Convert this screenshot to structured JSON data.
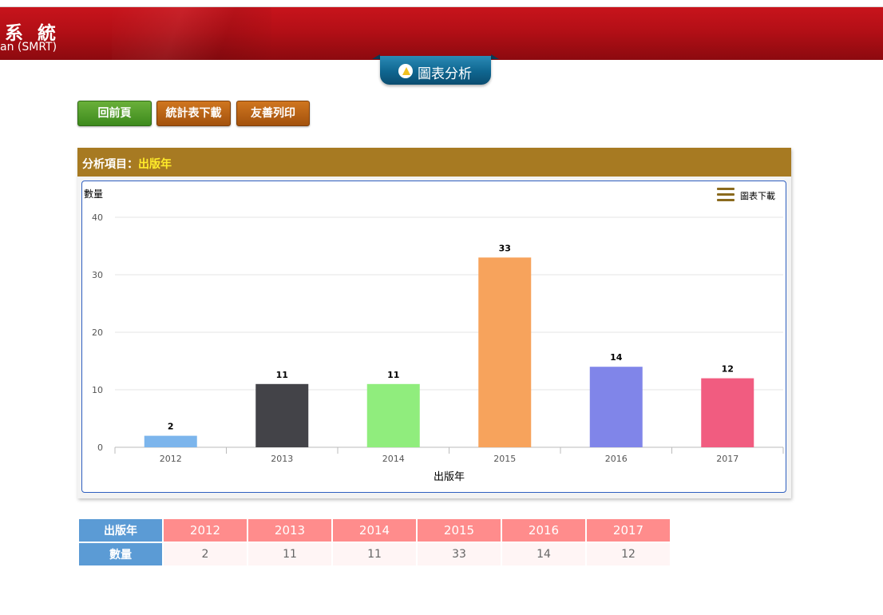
{
  "header": {
    "system_title": "系 統",
    "system_subtitle": "an (SMRT)"
  },
  "section_ribbon": {
    "label": "圖表分析",
    "icon": "chart-logo-icon"
  },
  "toolbar": {
    "back_label": "回前頁",
    "download_label": "統計表下載",
    "print_label": "友善列印"
  },
  "panel": {
    "item_key": "分析項目：",
    "item_value": "出版年"
  },
  "chart_menu": {
    "label": "圖表下載",
    "icon": "hamburger-menu-icon"
  },
  "chart_data": {
    "type": "bar",
    "title": "",
    "xlabel": "出版年",
    "ylabel": "數量",
    "categories": [
      "2012",
      "2013",
      "2014",
      "2015",
      "2016",
      "2017"
    ],
    "values": [
      2,
      11,
      11,
      33,
      14,
      12
    ],
    "colors": [
      "#7cb5ec",
      "#434348",
      "#90ed7d",
      "#f7a35c",
      "#8085e9",
      "#f15c80"
    ],
    "ylim": [
      0,
      40
    ],
    "yticks": [
      0,
      10,
      20,
      30,
      40
    ],
    "grid": true,
    "legend": "none"
  },
  "table": {
    "row_header_year": "出版年",
    "row_header_count": "數量",
    "years": [
      "2012",
      "2013",
      "2014",
      "2015",
      "2016",
      "2017"
    ],
    "counts": [
      "2",
      "11",
      "11",
      "33",
      "14",
      "12"
    ]
  }
}
